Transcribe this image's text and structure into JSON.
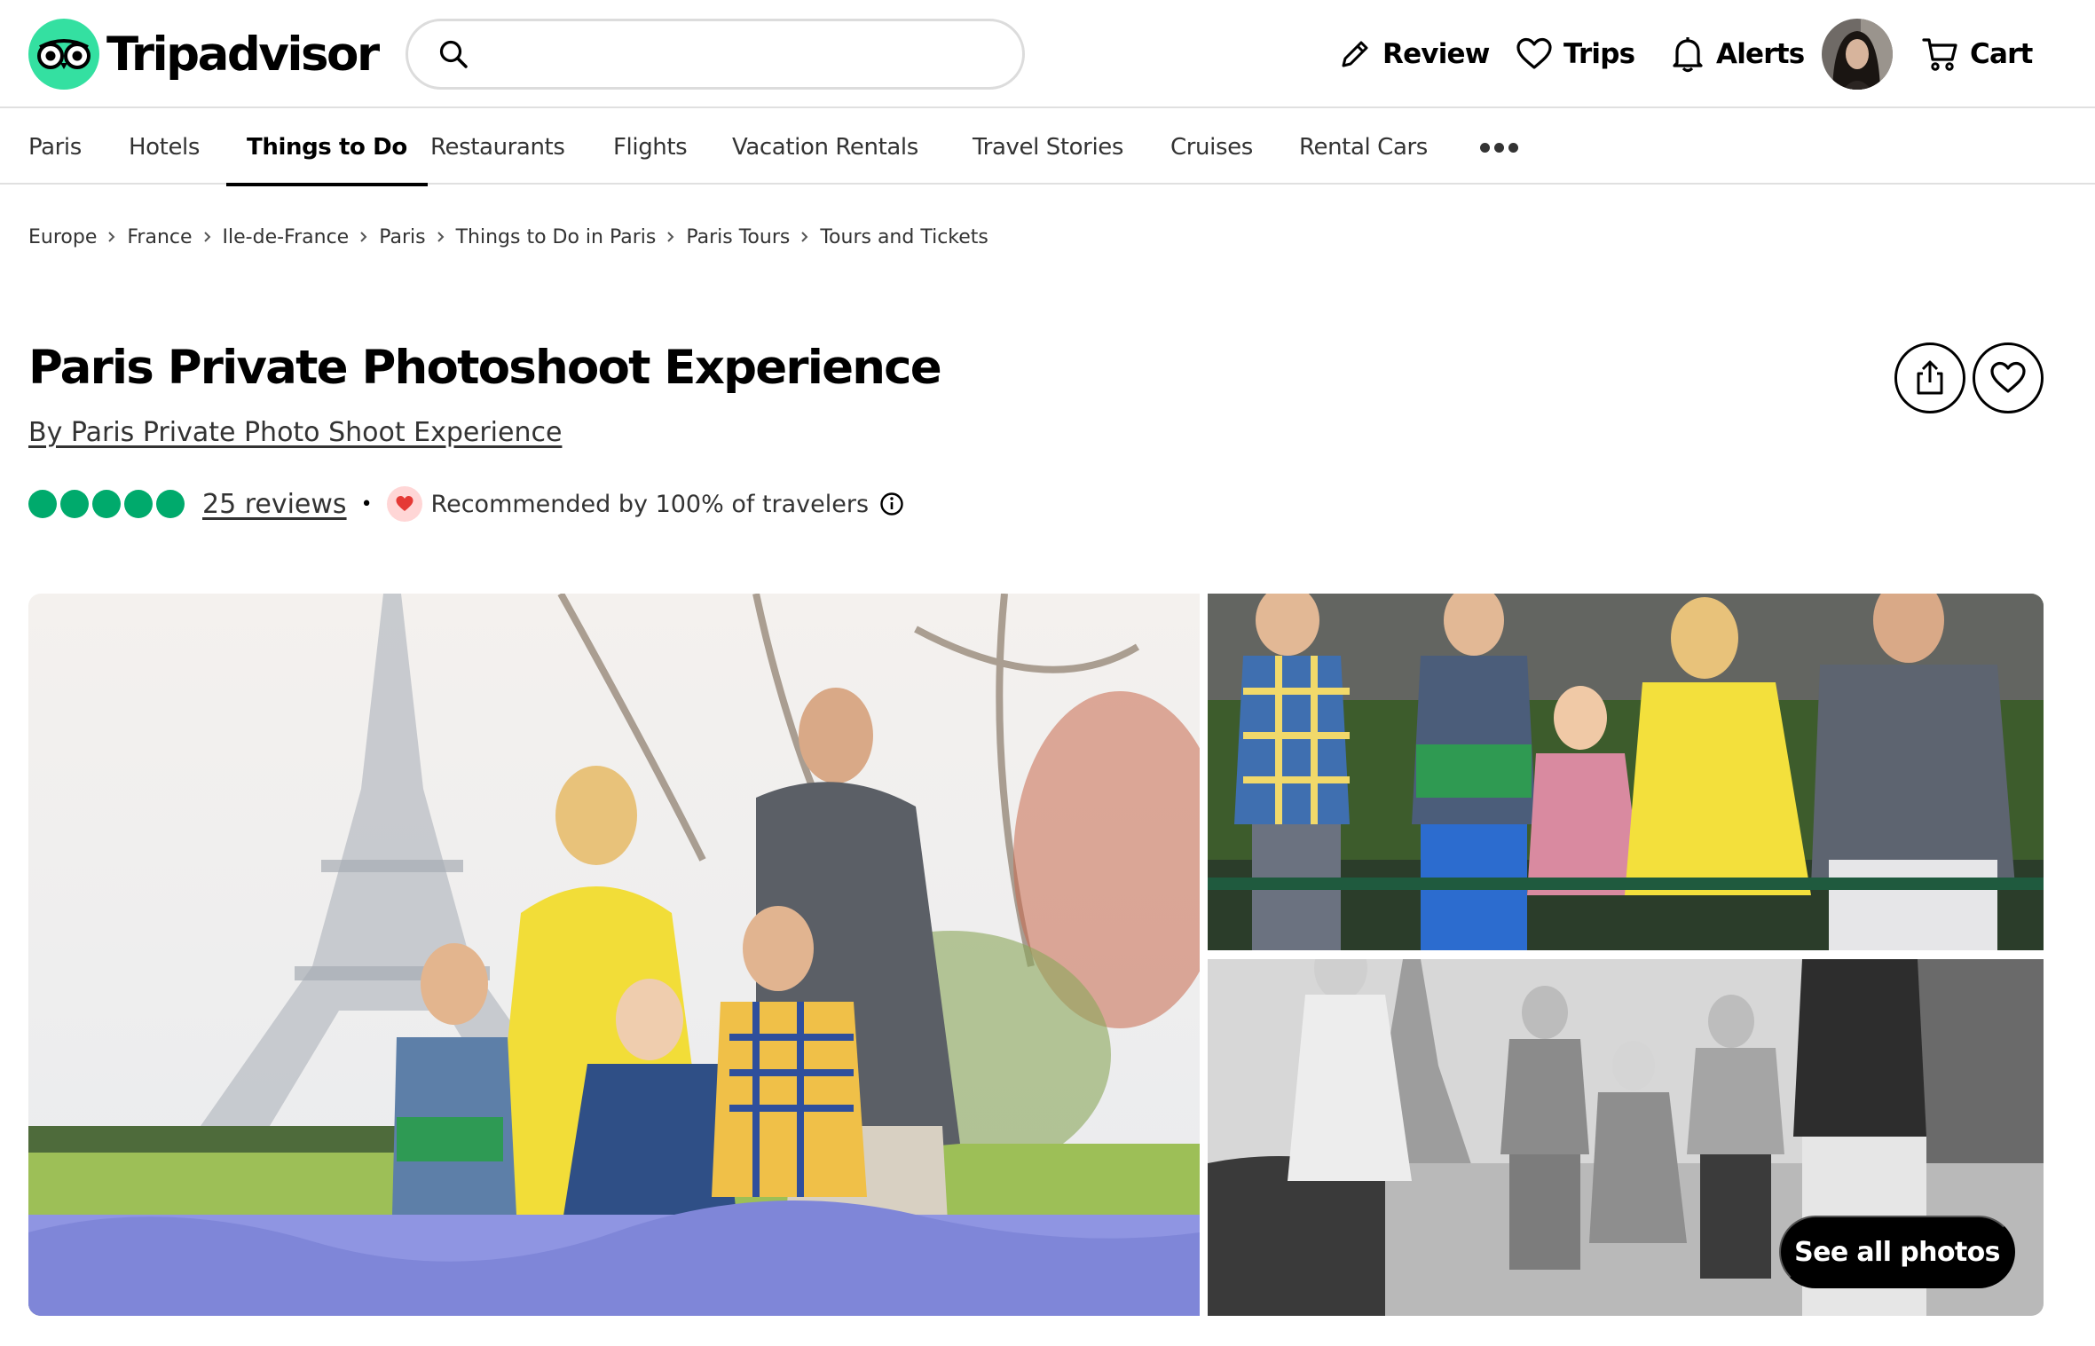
{
  "brand": {
    "name": "Tripadvisor",
    "logo_icon": "owl-eyes-icon",
    "accent": "#34e0a1"
  },
  "search": {
    "value": "",
    "placeholder": ""
  },
  "header_nav": {
    "review": {
      "label": "Review",
      "icon": "pencil-icon"
    },
    "trips": {
      "label": "Trips",
      "icon": "heart-icon"
    },
    "alerts": {
      "label": "Alerts",
      "icon": "bell-icon"
    },
    "cart": {
      "label": "Cart",
      "icon": "cart-icon"
    }
  },
  "tabs": [
    {
      "label": "Paris"
    },
    {
      "label": "Hotels"
    },
    {
      "label": "Things to Do",
      "active": true
    },
    {
      "label": "Restaurants"
    },
    {
      "label": "Flights"
    },
    {
      "label": "Vacation Rentals"
    },
    {
      "label": "Travel Stories"
    },
    {
      "label": "Cruises"
    },
    {
      "label": "Rental Cars"
    }
  ],
  "more_icon": "more-dots-icon",
  "breadcrumb": [
    "Europe",
    "France",
    "Ile-de-France",
    "Paris",
    "Things to Do in Paris",
    "Paris Tours",
    "Tours and Tickets"
  ],
  "listing": {
    "title": "Paris Private Photoshoot Experience",
    "byline": "By Paris Private Photo Shoot Experience",
    "rating_bubbles": 5,
    "rating_color": "#00aa6c",
    "reviews_label": "25 reviews",
    "separator": "•",
    "recommended_text": "Recommended by 100% of travelers"
  },
  "photos": {
    "see_all_label": "See all photos",
    "items": [
      "main-photo",
      "top-right-photo",
      "bottom-right-photo"
    ]
  }
}
